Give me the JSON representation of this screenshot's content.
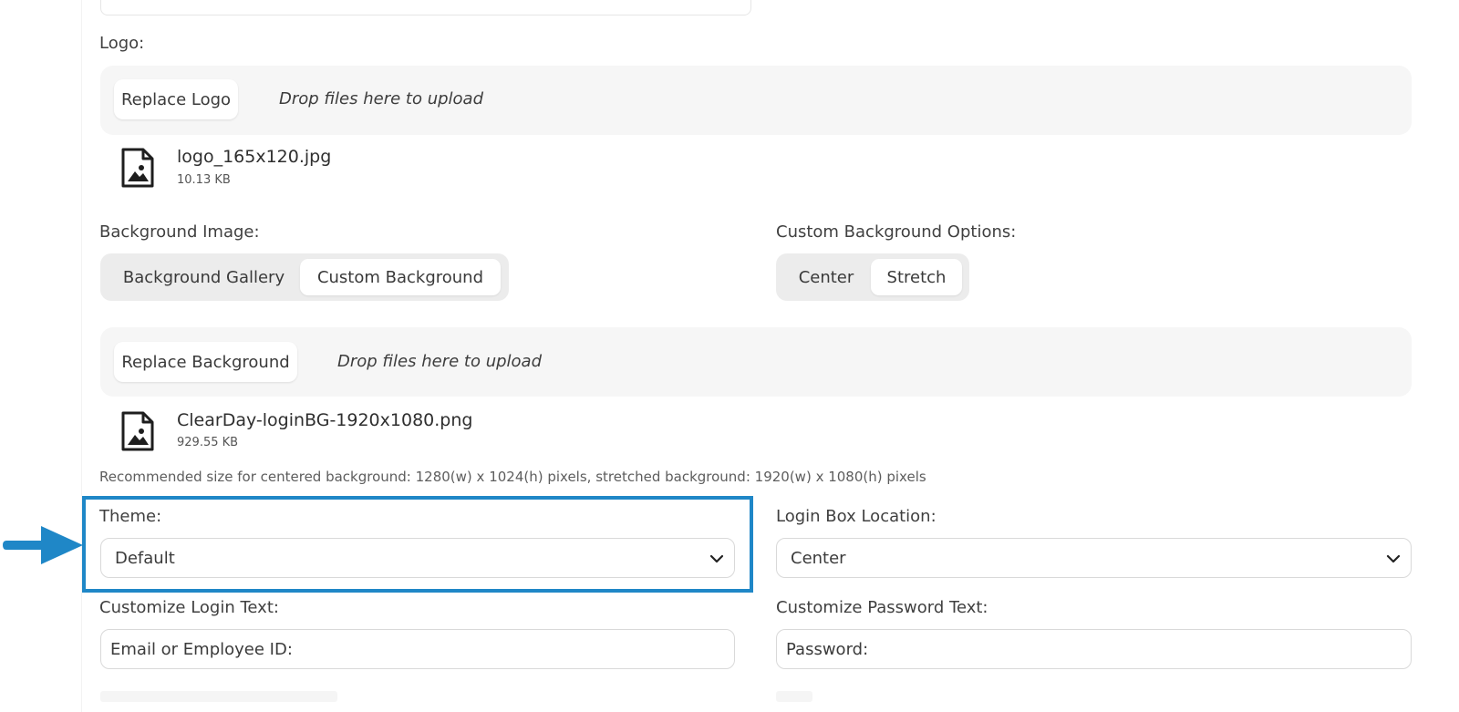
{
  "logo": {
    "label": "Logo:",
    "button": "Replace Logo",
    "drop_hint": "Drop files here to upload",
    "file_name": "logo_165x120.jpg",
    "file_size": "10.13 KB"
  },
  "background": {
    "label": "Background Image:",
    "options": [
      "Background Gallery",
      "Custom Background"
    ],
    "selected": "Custom Background",
    "button": "Replace Background",
    "drop_hint": "Drop files here to upload",
    "file_name": "ClearDay-loginBG-1920x1080.png",
    "file_size": "929.55 KB",
    "recommendation": "Recommended size for centered background: 1280(w) x 1024(h) pixels, stretched background: 1920(w) x 1080(h) pixels"
  },
  "custom_background_options": {
    "label": "Custom Background Options:",
    "options": [
      "Center",
      "Stretch"
    ],
    "selected": "Stretch"
  },
  "theme": {
    "label": "Theme:",
    "value": "Default"
  },
  "login_box_location": {
    "label": "Login Box Location:",
    "value": "Center"
  },
  "login_text": {
    "label": "Customize Login Text:",
    "value": "Email or Employee ID:"
  },
  "password_text": {
    "label": "Customize Password Text:",
    "value": "Password:"
  },
  "colors": {
    "accent": "#1f87c7",
    "panel_bg": "#f6f6f6",
    "segmented_bg": "#ececec"
  },
  "icons": {
    "file": "image-file-icon",
    "chevron": "chevron-down-icon",
    "annotation": "arrow-right-icon"
  }
}
